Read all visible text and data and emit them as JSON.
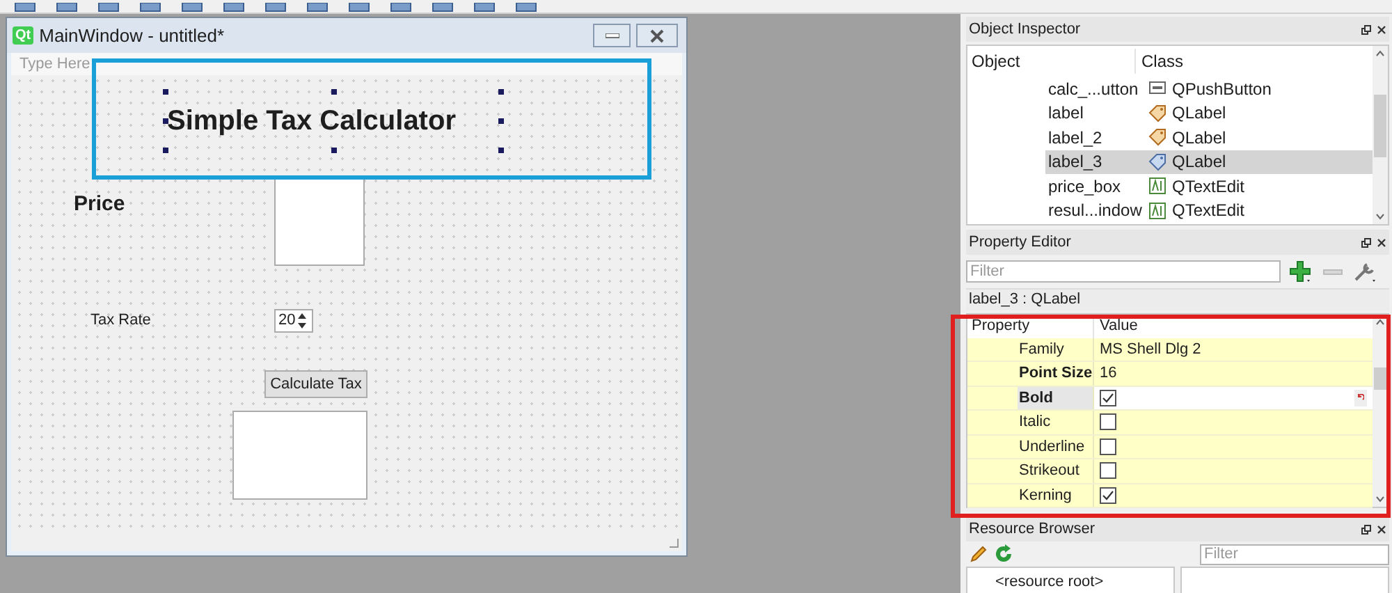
{
  "designer_window": {
    "logo_text": "Qt",
    "title": "MainWindow - untitled*",
    "menu_placeholder": "Type Here",
    "widgets": [
      {
        "kind": "label",
        "text": "Simple Tax Calculator",
        "bold": true,
        "selected": true
      },
      {
        "kind": "label",
        "text": "Price",
        "bold": true,
        "selected": false
      },
      {
        "kind": "text_edit",
        "selected": false
      },
      {
        "kind": "label",
        "text": "Tax Rate",
        "bold": false,
        "selected": false
      },
      {
        "kind": "spin_box",
        "value": "20",
        "selected": false
      },
      {
        "kind": "button",
        "text": "Calculate Tax",
        "selected": false
      },
      {
        "kind": "text_edit",
        "selected": false
      }
    ]
  },
  "object_inspector": {
    "title": "Object Inspector",
    "columns": [
      "Object",
      "Class"
    ],
    "rows": [
      {
        "object": "calc_...utton",
        "class": "QPushButton",
        "kind": "button",
        "selected": false
      },
      {
        "object": "label",
        "class": "QLabel",
        "kind": "label",
        "selected": false
      },
      {
        "object": "label_2",
        "class": "QLabel",
        "kind": "label",
        "selected": false
      },
      {
        "object": "label_3",
        "class": "QLabel",
        "kind": "label",
        "selected": true
      },
      {
        "object": "price_box",
        "class": "QTextEdit",
        "kind": "text_edit",
        "selected": false
      },
      {
        "object": "resul...indow",
        "class": "QTextEdit",
        "kind": "text_edit",
        "selected": false
      }
    ]
  },
  "property_editor": {
    "title": "Property Editor",
    "filter_placeholder": "Filter",
    "object_label": "label_3 : QLabel",
    "columns": [
      "Property",
      "Value"
    ],
    "rows": [
      {
        "kind": "text",
        "name": "Family",
        "value": "MS Shell Dlg 2",
        "modified": false,
        "selected": false
      },
      {
        "kind": "text",
        "name": "Point Size",
        "value": "16",
        "modified": true,
        "selected": false
      },
      {
        "kind": "checkbox",
        "name": "Bold",
        "checked": true,
        "modified": true,
        "selected": true
      },
      {
        "kind": "checkbox",
        "name": "Italic",
        "checked": false,
        "modified": false,
        "selected": false
      },
      {
        "kind": "checkbox",
        "name": "Underline",
        "checked": false,
        "modified": false,
        "selected": false
      },
      {
        "kind": "checkbox",
        "name": "Strikeout",
        "checked": false,
        "modified": false,
        "selected": false
      },
      {
        "kind": "checkbox",
        "name": "Kerning",
        "checked": true,
        "modified": false,
        "selected": false
      }
    ]
  },
  "resource_browser": {
    "title": "Resource Browser",
    "filter_placeholder": "Filter",
    "root": "<resource root>"
  }
}
